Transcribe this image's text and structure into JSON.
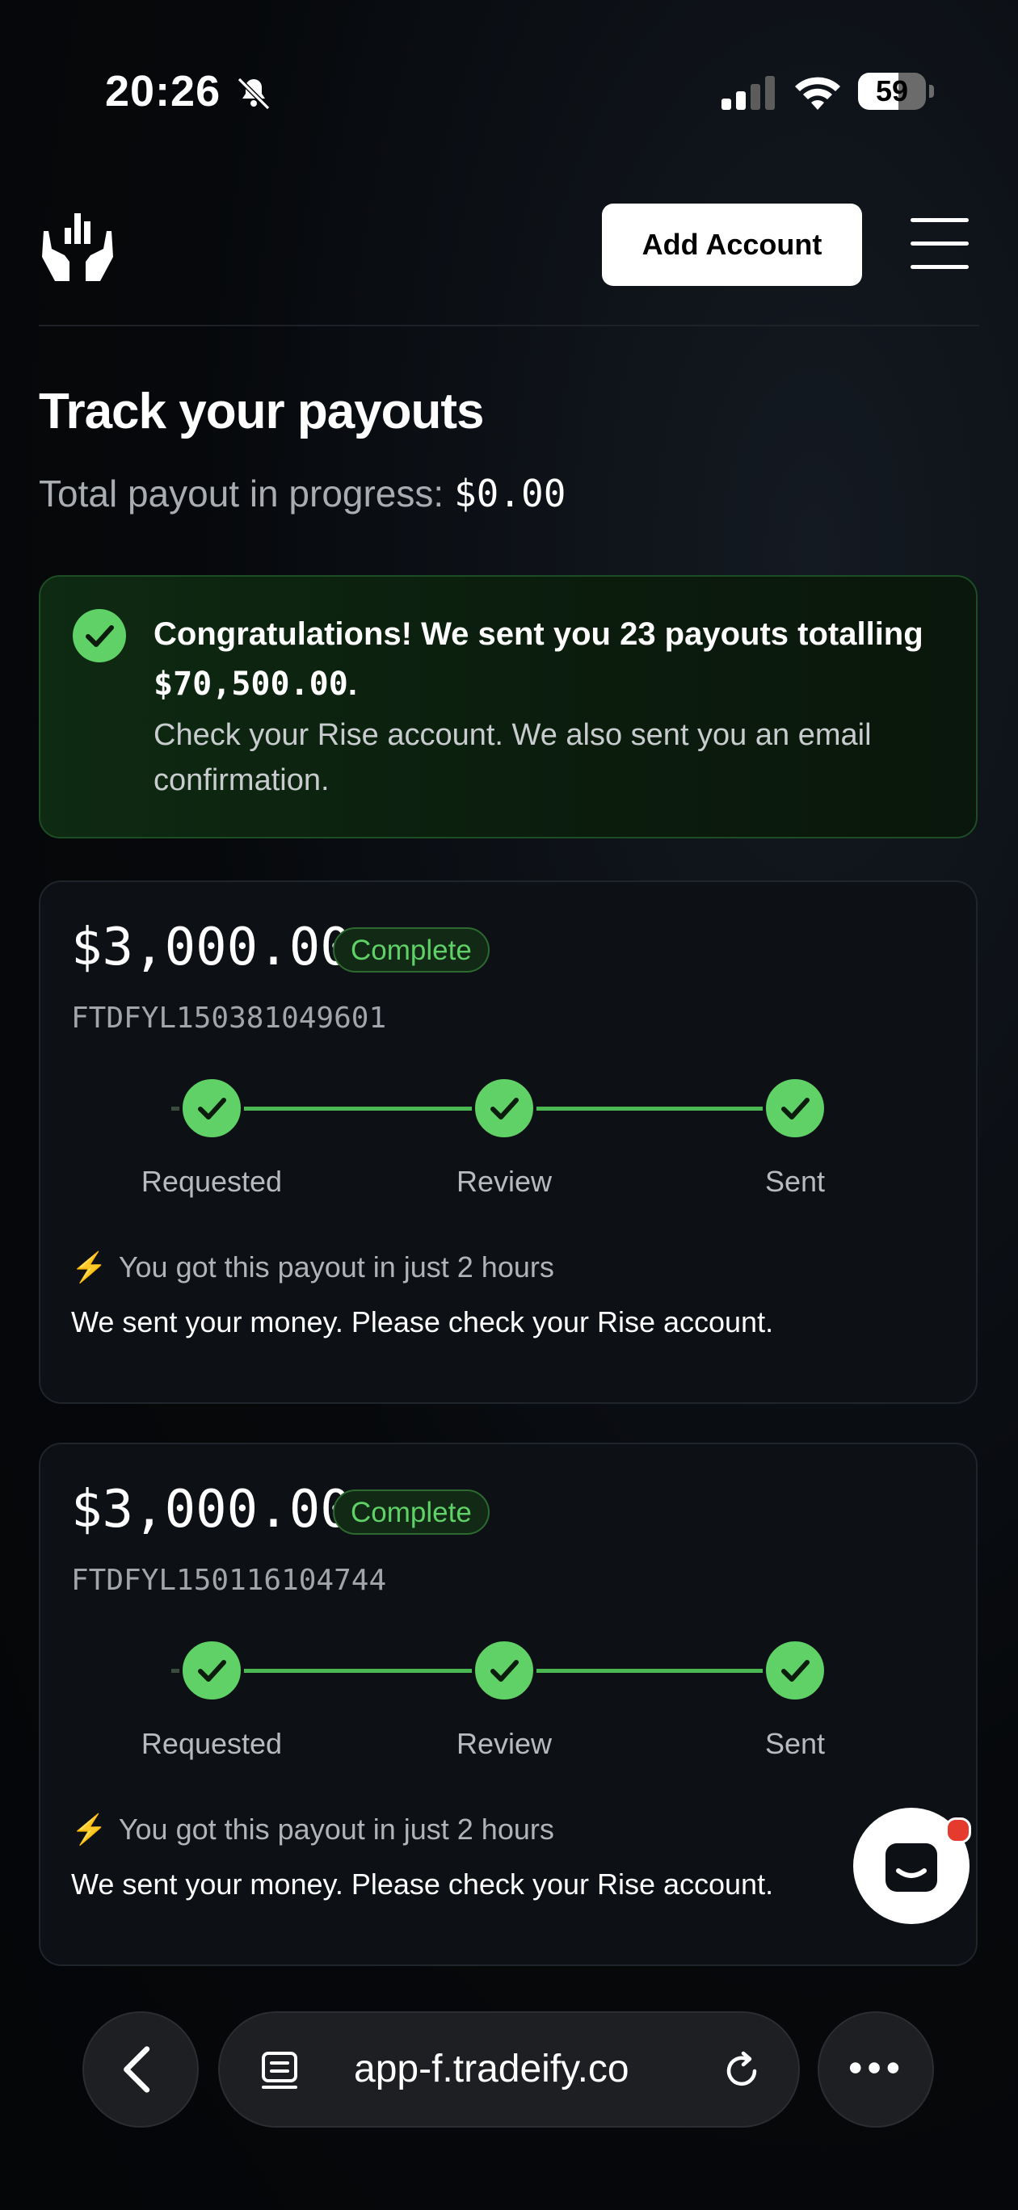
{
  "status_bar": {
    "time": "20:26",
    "battery": "59",
    "battery_level": 0.59
  },
  "header": {
    "add_account_label": "Add Account"
  },
  "page": {
    "title": "Track your payouts",
    "total_label": "Total payout in progress: ",
    "total_value": "$0.00"
  },
  "banner": {
    "title_prefix": "Congratulations! We sent you 23 payouts totalling ",
    "title_amount": "$70,500.00",
    "title_suffix": ".",
    "text": "Check your Rise account. We also sent you an email confirmation."
  },
  "payouts": [
    {
      "amount": "$3,000.00",
      "status": "Complete",
      "ref": "FTDFYL150381049601",
      "steps": [
        "Requested",
        "Review",
        "Sent"
      ],
      "speed_icon": "⚡",
      "speed_text": "You got this payout in just 2 hours",
      "message": "We sent your money. Please check your Rise account."
    },
    {
      "amount": "$3,000.00",
      "status": "Complete",
      "ref": "FTDFYL150116104744",
      "steps": [
        "Requested",
        "Review",
        "Sent"
      ],
      "speed_icon": "⚡",
      "speed_text": "You got this payout in just 2 hours",
      "message": "We sent your money. Please check your Rise account."
    }
  ],
  "browser": {
    "url": "app-f.tradeify.co"
  },
  "colors": {
    "accent_green": "#5fd166",
    "alert_red": "#e53b2f"
  }
}
